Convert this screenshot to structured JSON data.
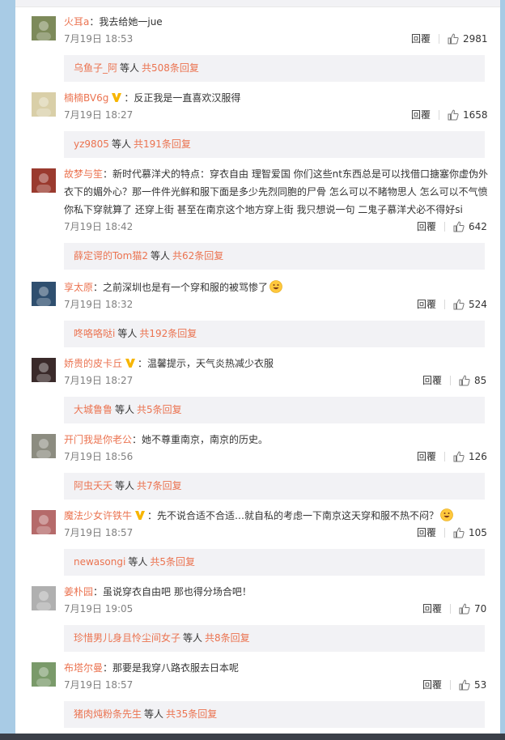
{
  "comments": [
    {
      "user": "火耳a",
      "text": "：我去给她一jue",
      "time": "7月19日 18:53",
      "reply": "回覆",
      "likes": "2981",
      "sub_user": "乌鱼子_阿",
      "sub_mid": "等人",
      "sub_count": "共508条回复",
      "avatar_color": "#7d8a5a",
      "verified": false,
      "emoji": ""
    },
    {
      "user": "楠楠BV6g",
      "text": "：反正我是一直喜欢汉服得",
      "time": "7月19日 18:27",
      "reply": "回覆",
      "likes": "1658",
      "sub_user": "yz9805",
      "sub_mid": "等人",
      "sub_count": "共191条回复",
      "avatar_color": "#d9cfa8",
      "verified": true,
      "emoji": ""
    },
    {
      "user": "故梦与笙",
      "text": "：新时代慕洋犬的特点：穿衣自由 理智爱国 你们这些nt东西总是可以找借口搪塞你虚伪外衣下的媚外心？那一件件光鲜和服下面是多少先烈同胞的尸骨 怎么可以不睹物思人 怎么可以不气愤 你私下穿就算了 还穿上街 甚至在南京这个地方穿上街 我只想说一句 二鬼子慕洋犬必不得好si",
      "time": "7月19日 18:42",
      "reply": "回覆",
      "likes": "642",
      "sub_user": "薛定谔的Tom猫2",
      "sub_mid": "等人",
      "sub_count": "共62条回复",
      "avatar_color": "#9a3a2e",
      "verified": false,
      "emoji": ""
    },
    {
      "user": "享太原",
      "text": "：之前深圳也是有一个穿和服的被骂惨了",
      "time": "7月19日 18:32",
      "reply": "回覆",
      "likes": "524",
      "sub_user": "咚咯咯哒i",
      "sub_mid": "等人",
      "sub_count": "共192条回复",
      "avatar_color": "#2f4f6f",
      "verified": false,
      "emoji": "laugh"
    },
    {
      "user": "娇贵的皮卡丘",
      "text": "：温馨提示，天气炎热减少衣服",
      "time": "7月19日 18:27",
      "reply": "回覆",
      "likes": "85",
      "sub_user": "大城鲁鲁",
      "sub_mid": "等人",
      "sub_count": "共5条回复",
      "avatar_color": "#3a2a2a",
      "verified": true,
      "emoji": ""
    },
    {
      "user": "开门我是你老公",
      "text": "：她不尊重南京，南京的历史。",
      "time": "7月19日 18:56",
      "reply": "回覆",
      "likes": "126",
      "sub_user": "阿虫夭夭",
      "sub_mid": "等人",
      "sub_count": "共7条回复",
      "avatar_color": "#8c8c80",
      "verified": false,
      "emoji": ""
    },
    {
      "user": "魔法少女许铁牛",
      "text": "：先不说合适不合适…就自私的考虑一下南京这天穿和服不热不闷？",
      "time": "7月19日 18:57",
      "reply": "回覆",
      "likes": "105",
      "sub_user": "newasongi",
      "sub_mid": "等人",
      "sub_count": "共5条回复",
      "avatar_color": "#b56a6a",
      "verified": true,
      "emoji": "sweat"
    },
    {
      "user": "姜朴园",
      "text": "：虽说穿衣自由吧 那也得分场合吧！",
      "time": "7月19日 19:05",
      "reply": "回覆",
      "likes": "70",
      "sub_user": "珍惜男儿身且怜尘间女子",
      "sub_mid": "等人",
      "sub_count": "共8条回复",
      "avatar_color": "#b0b0b0",
      "verified": false,
      "emoji": ""
    },
    {
      "user": "布塔尔曼",
      "text": "：那要是我穿八路衣服去日本呢",
      "time": "7月19日 18:57",
      "reply": "回覆",
      "likes": "53",
      "sub_user": "猪肉炖粉条先生",
      "sub_mid": "等人",
      "sub_count": "共35条回复",
      "avatar_color": "#7a9a6a",
      "verified": false,
      "emoji": ""
    }
  ],
  "colors": {
    "accent": "#eb7350",
    "page_bg": "#a8cbe5",
    "sub_bg": "#f2f2f5"
  }
}
